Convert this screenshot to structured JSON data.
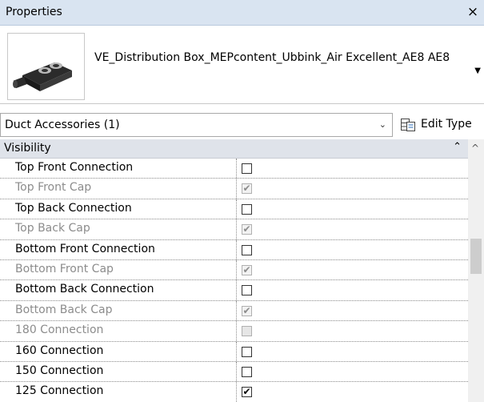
{
  "panel": {
    "title": "Properties",
    "close_glyph": "×",
    "close_icon": "close-icon"
  },
  "type_selector": {
    "name": "VE_Distribution Box_MEPcontent_Ubbink_Air Excellent_AE8 AE8",
    "dropdown_glyph": "▼",
    "thumbnail_icon": "distribution-box-icon"
  },
  "filter": {
    "label": "Duct Accessories (1)",
    "arrow_glyph": "⌄",
    "edit_type_label": "Edit Type",
    "edit_type_icon": "edit-type-icon"
  },
  "group": {
    "label": "Visibility",
    "collapse_glyph": "⌃"
  },
  "rows": [
    {
      "label": "Top Front Connection",
      "checked": "",
      "disabled": false
    },
    {
      "label": "Top Front Cap",
      "checked": "✔",
      "disabled": true
    },
    {
      "label": "Top Back Connection",
      "checked": "",
      "disabled": false
    },
    {
      "label": "Top Back Cap",
      "checked": "✔",
      "disabled": true
    },
    {
      "label": "Bottom Front Connection",
      "checked": "",
      "disabled": false
    },
    {
      "label": "Bottom Front Cap",
      "checked": "✔",
      "disabled": true
    },
    {
      "label": "Bottom Back Connection",
      "checked": "",
      "disabled": false
    },
    {
      "label": "Bottom Back Cap",
      "checked": "✔",
      "disabled": true
    },
    {
      "label": "180 Connection",
      "checked": "",
      "disabled": true
    },
    {
      "label": "160 Connection",
      "checked": "",
      "disabled": false
    },
    {
      "label": "150 Connection",
      "checked": "",
      "disabled": false
    },
    {
      "label": "125 Connection",
      "checked": "✔",
      "disabled": false
    }
  ],
  "scrollbar": {
    "up_glyph": "^"
  }
}
